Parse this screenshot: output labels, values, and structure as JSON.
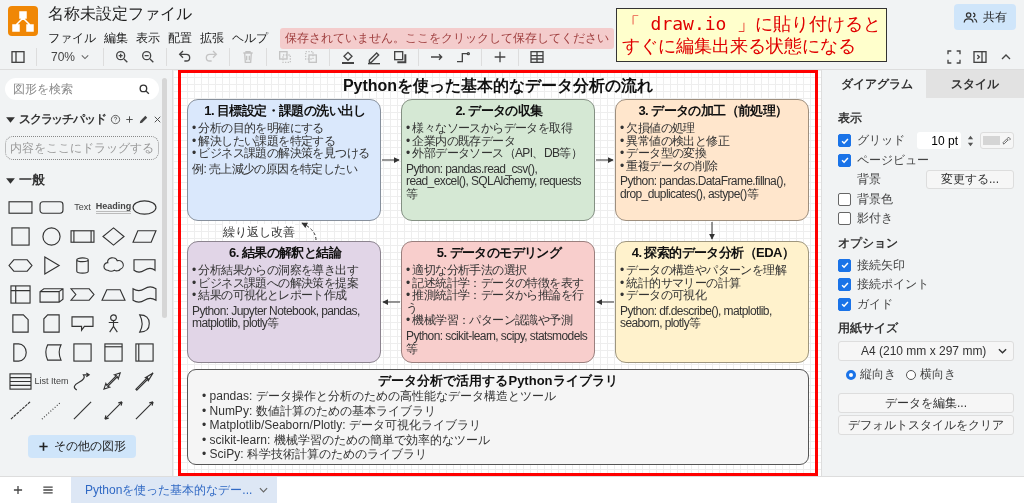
{
  "app": {
    "title": "名称未設定ファイル",
    "menus": [
      "ファイル",
      "編集",
      "表示",
      "配置",
      "拡張",
      "ヘルプ"
    ],
    "save_notice": "保存されていません。ここをクリックして保存してください",
    "share": "共有"
  },
  "annotation": {
    "lines": [
      "「 draw.io 」に貼り付けると",
      "すぐに編集出来る状態になる"
    ]
  },
  "toolbar": {
    "zoom": "70%",
    "buttons": [
      {
        "kind": "zoom-in",
        "disabled": false
      },
      {
        "kind": "zoom-out",
        "disabled": false
      },
      {
        "kind": "sep"
      },
      {
        "kind": "undo",
        "disabled": false
      },
      {
        "kind": "redo",
        "disabled": true
      },
      {
        "kind": "sep"
      },
      {
        "kind": "delete",
        "disabled": true
      },
      {
        "kind": "sep"
      },
      {
        "kind": "to-front",
        "disabled": true
      },
      {
        "kind": "to-back",
        "disabled": true
      },
      {
        "kind": "sep"
      },
      {
        "kind": "fill",
        "disabled": false
      },
      {
        "kind": "line-color",
        "disabled": false
      },
      {
        "kind": "shadow",
        "disabled": false
      },
      {
        "kind": "sep"
      },
      {
        "kind": "connection",
        "disabled": false
      },
      {
        "kind": "waypoint",
        "disabled": false
      },
      {
        "kind": "sep"
      },
      {
        "kind": "insert",
        "disabled": false
      },
      {
        "kind": "sep"
      },
      {
        "kind": "table",
        "disabled": false
      }
    ]
  },
  "sidebar": {
    "search_placeholder": "図形を検索",
    "scratchpad": {
      "title": "スクラッチパッド",
      "expanded": true,
      "drop_hint": "内容をここにドラッグする"
    },
    "general": {
      "title": "一般",
      "expanded": true,
      "shapes": [
        {
          "kind": "rect"
        },
        {
          "kind": "rounded"
        },
        {
          "kind": "text",
          "label": "Text"
        },
        {
          "kind": "heading",
          "label": "Heading"
        },
        {
          "kind": "ellipse"
        },
        {
          "kind": "square"
        },
        {
          "kind": "circle"
        },
        {
          "kind": "process"
        },
        {
          "kind": "diamond"
        },
        {
          "kind": "parallelogram"
        },
        {
          "kind": "hexagon"
        },
        {
          "kind": "triangle"
        },
        {
          "kind": "cylinder"
        },
        {
          "kind": "cloud"
        },
        {
          "kind": "document"
        },
        {
          "kind": "internal"
        },
        {
          "kind": "cube"
        },
        {
          "kind": "step"
        },
        {
          "kind": "trapezoid"
        },
        {
          "kind": "tape"
        },
        {
          "kind": "note"
        },
        {
          "kind": "card"
        },
        {
          "kind": "callout"
        },
        {
          "kind": "actor"
        },
        {
          "kind": "or"
        },
        {
          "kind": "delay"
        },
        {
          "kind": "storage"
        },
        {
          "kind": "square"
        },
        {
          "kind": "container"
        },
        {
          "kind": "vlines"
        },
        {
          "kind": "list"
        },
        {
          "kind": "listitem",
          "label": "List Item"
        },
        {
          "kind": "curve"
        },
        {
          "kind": "doublearrow"
        },
        {
          "kind": "bigarrow"
        },
        {
          "kind": "dashed"
        },
        {
          "kind": "dotted"
        },
        {
          "kind": "line"
        },
        {
          "kind": "bidir"
        },
        {
          "kind": "directional"
        }
      ]
    },
    "more_shapes": "その他の図形"
  },
  "diagram": {
    "title": "Pythonを使った基本的なデータ分析の流れ",
    "steps": [
      {
        "title": "1. 目標設定・課題の洗い出し",
        "color": "#dae8fc",
        "bullets": [
          "• 分析の目的を明確にする",
          "• 解決したい課題を特定する",
          "• ビジネス課題の解決策を見つける"
        ],
        "note": "例: 売上減少の原因を特定したい"
      },
      {
        "title": "2. データの収集",
        "color": "#d5e8d4",
        "bullets": [
          "• 様々なソースからデータを取得",
          "• 企業内の既存データ",
          "• 外部データソース（API、DB等）"
        ],
        "note": "Python: pandas.read_csv(), read_excel(), SQLAlchemy, requests等"
      },
      {
        "title": "3. データの加工（前処理）",
        "color": "#ffe6cc",
        "bullets": [
          "• 欠損値の処理",
          "• 異常値の検出と修正",
          "• データ型の変換",
          "• 重複データの削除"
        ],
        "note": "Python: pandas.DataFrame.fillna(), drop_duplicates(), astype()等"
      },
      {
        "title": "6. 結果の解釈と結論",
        "color": "#e1d5e7",
        "bullets": [
          "• 分析結果からの洞察を導き出す",
          "• ビジネス課題への解決策を提案",
          "• 結果の可視化とレポート作成"
        ],
        "note": "Python: Jupyter Notebook, pandas, matplotlib, plotly等"
      },
      {
        "title": "5. データのモデリング",
        "color": "#f8cecc",
        "bullets": [
          "• 適切な分析手法の選択",
          "• 記述統計学：データの特徴を表す",
          "• 推測統計学：データから推論を行う",
          "• 機械学習：パターン認識や予測"
        ],
        "note": "Python: scikit-learn, scipy, statsmodels等"
      },
      {
        "title": "4. 探索的データ分析（EDA）",
        "color": "#fff2cc",
        "bullets": [
          "• データの構造やパターンを理解",
          "• 統計的サマリーの計算",
          "• データの可視化"
        ],
        "note": "Python: df.describe(), matplotlib, seaborn, plotly等"
      }
    ],
    "feedback_label": "繰り返し改善",
    "library": {
      "title": "データ分析で活用するPythonライブラリ",
      "items": [
        "• pandas: データ操作と分析のための高性能なデータ構造とツール",
        "• NumPy: 数値計算のための基本ライブラリ",
        "• Matplotlib/Seaborn/Plotly: データ可視化ライブラリ",
        "• scikit-learn: 機械学習のための簡単で効率的なツール",
        "• SciPy: 科学技術計算のためのライブラリ"
      ]
    }
  },
  "format_panel": {
    "tabs": [
      {
        "label": "ダイアグラム",
        "selected": true
      },
      {
        "label": "スタイル",
        "selected": false
      }
    ],
    "display": {
      "heading": "表示",
      "rows": [
        {
          "kind": "grid",
          "label": "グリッド",
          "checked": true,
          "value": "10 pt"
        },
        {
          "kind": "checkbox",
          "label": "ページビュー",
          "checked": true
        },
        {
          "kind": "button",
          "label": "背景",
          "button": "変更する..."
        },
        {
          "kind": "checkbox",
          "label": "背景色",
          "checked": false
        },
        {
          "kind": "checkbox",
          "label": "影付き",
          "checked": false
        }
      ]
    },
    "options": {
      "heading": "オプション",
      "rows": [
        {
          "label": "接続矢印",
          "checked": true
        },
        {
          "label": "接続ポイント",
          "checked": true
        },
        {
          "label": "ガイド",
          "checked": true
        }
      ]
    },
    "paper": {
      "heading": "用紙サイズ",
      "size": "A4 (210 mm x 297 mm)",
      "orientations": [
        {
          "label": "縦向き",
          "selected": true
        },
        {
          "label": "横向き",
          "selected": false
        }
      ]
    },
    "actions": [
      "データを編集...",
      "デフォルトスタイルをクリア"
    ]
  },
  "pages": [
    {
      "label": "Pythonを使った基本的なデー...",
      "selected": true
    }
  ]
}
